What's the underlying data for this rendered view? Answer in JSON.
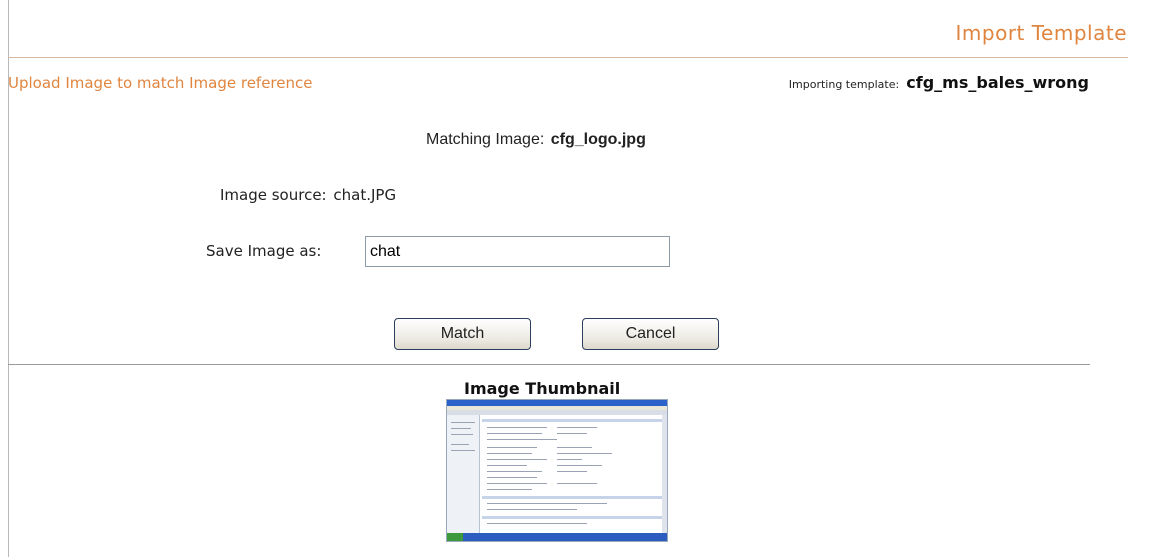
{
  "header": {
    "title": "Import Template"
  },
  "subheader": {
    "instruction": "Upload Image to match Image reference",
    "importing_label": "Importing template:",
    "importing_value": "cfg_ms_bales_wrong"
  },
  "form": {
    "matching_label": "Matching Image:",
    "matching_value": "cfg_logo.jpg",
    "source_label": "Image source:",
    "source_value": "chat.JPG",
    "save_label": "Save Image as:",
    "save_value": "chat"
  },
  "buttons": {
    "match": "Match",
    "cancel": "Cancel"
  },
  "thumbnail": {
    "title": "Image Thumbnail"
  },
  "colors": {
    "accent": "#e0853f"
  }
}
